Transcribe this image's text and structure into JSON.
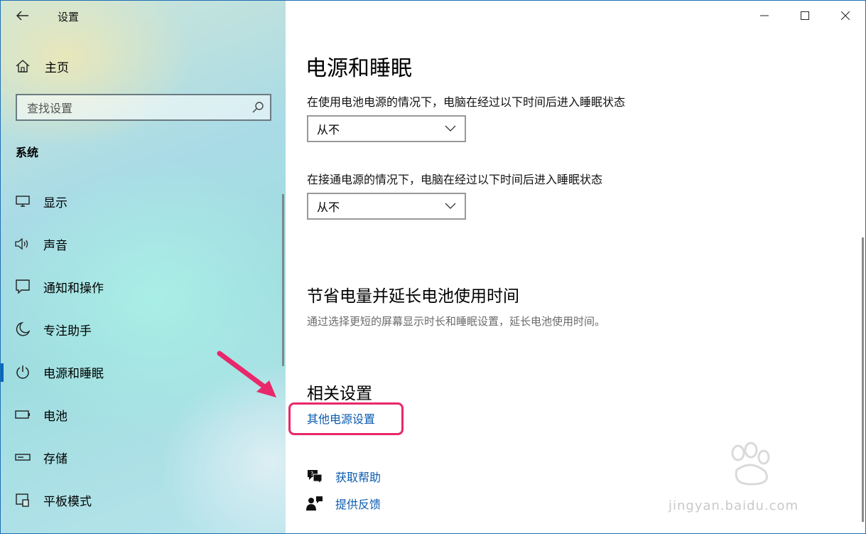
{
  "window": {
    "title": "设置",
    "controls": {
      "minimize": "minimize-icon",
      "maximize": "maximize-icon",
      "close": "close-icon"
    }
  },
  "sidebar": {
    "home_label": "主页",
    "search_placeholder": "查找设置",
    "section_title": "系统",
    "items": [
      {
        "label": "显示",
        "icon": "monitor-icon"
      },
      {
        "label": "声音",
        "icon": "speaker-icon"
      },
      {
        "label": "通知和操作",
        "icon": "notification-icon"
      },
      {
        "label": "专注助手",
        "icon": "moon-icon"
      },
      {
        "label": "电源和睡眠",
        "icon": "power-icon",
        "active": true
      },
      {
        "label": "电池",
        "icon": "battery-icon"
      },
      {
        "label": "存储",
        "icon": "storage-icon"
      },
      {
        "label": "平板模式",
        "icon": "tablet-icon"
      }
    ]
  },
  "main": {
    "title": "电源和睡眠",
    "battery_sleep_label": "在使用电池电源的情况下，电脑在经过以下时间后进入睡眠状态",
    "battery_sleep_value": "从不",
    "plugged_sleep_label": "在接通电源的情况下，电脑在经过以下时间后进入睡眠状态",
    "plugged_sleep_value": "从不",
    "save_heading": "节省电量并延长电池使用时间",
    "save_desc": "通过选择更短的屏幕显示时长和睡眠设置，延长电池使用时间。",
    "related_heading": "相关设置",
    "other_power_link": "其他电源设置",
    "get_help": "获取帮助",
    "feedback": "提供反馈"
  },
  "watermark": {
    "text": "jingyan.baidu.com"
  },
  "colors": {
    "accent": "#0067c0",
    "link": "#0a5bb0",
    "annotation": "#e8286b"
  }
}
